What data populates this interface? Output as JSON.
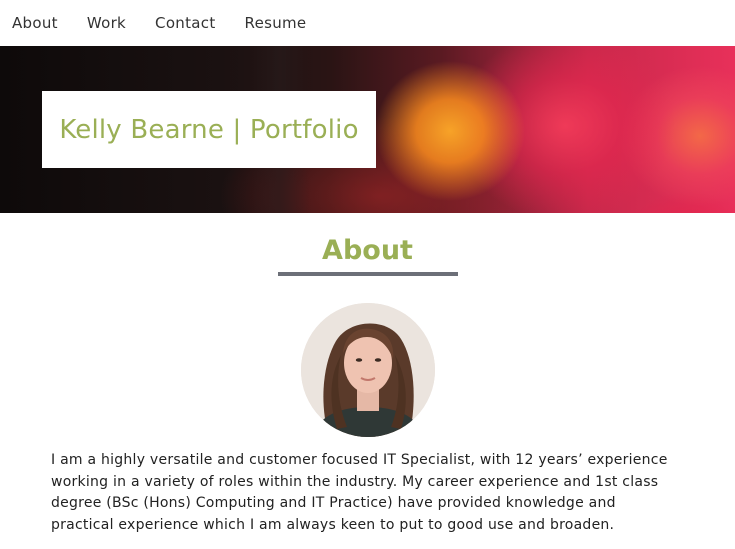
{
  "nav": {
    "items": [
      {
        "label": "About"
      },
      {
        "label": "Work"
      },
      {
        "label": "Contact"
      },
      {
        "label": "Resume"
      }
    ]
  },
  "hero": {
    "title": "Kelly Bearne | Portfolio"
  },
  "about": {
    "heading": "About",
    "body": "I am a highly versatile and customer focused IT Specialist, with 12 years’ experience working in a variety of roles within the industry. My career experience and 1st class degree (BSc (Hons) Computing and IT Practice) have provided knowledge and practical experience which I am always keen to put to good use and broaden."
  },
  "colors": {
    "accent": "#9aaf55",
    "underline": "#6c6f78",
    "text": "#222222"
  }
}
